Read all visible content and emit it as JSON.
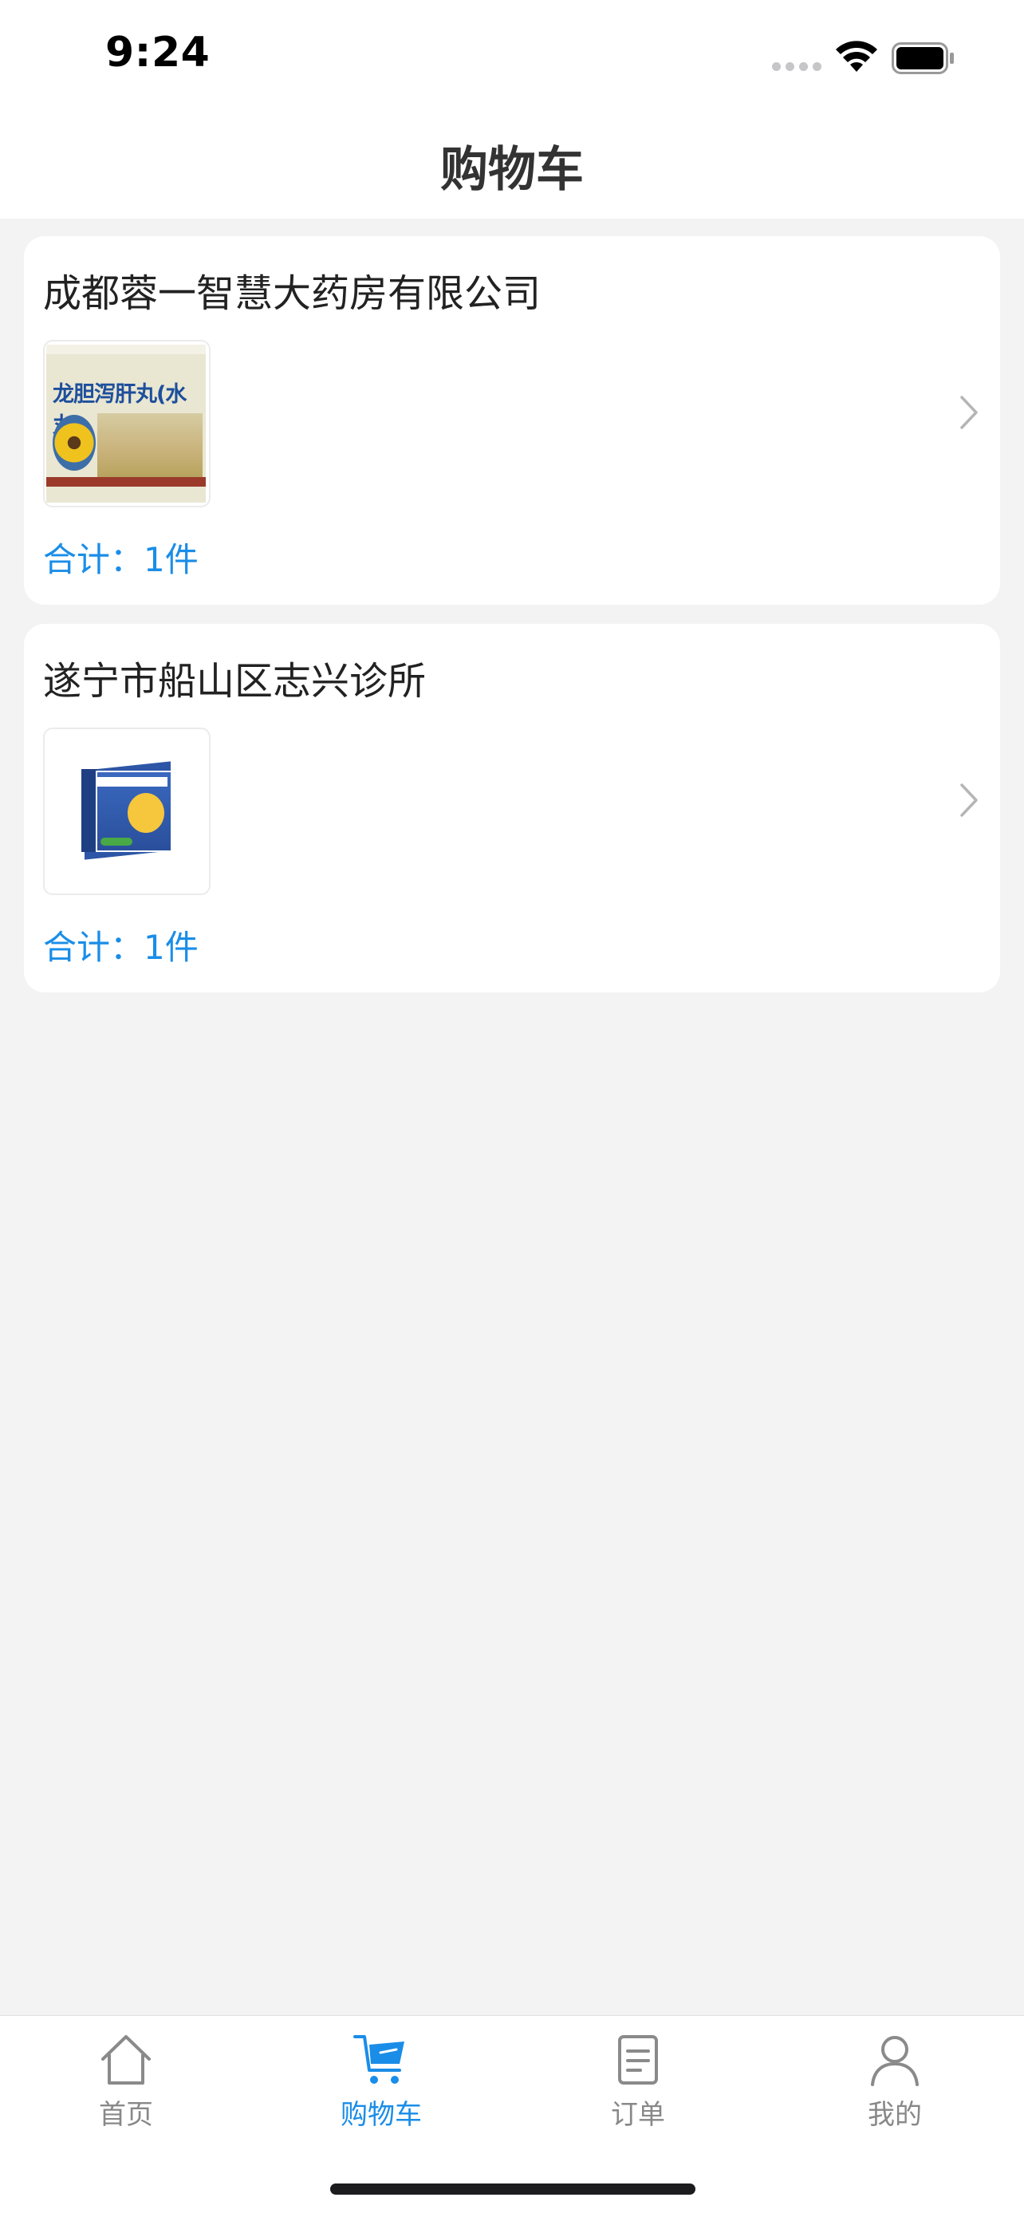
{
  "status_bar": {
    "time": "9:24",
    "icons": [
      "cellular-signal-icon",
      "wifi-icon",
      "battery-icon"
    ]
  },
  "header": {
    "title": "购物车"
  },
  "cart": {
    "stores": [
      {
        "name": "成都蓉一智慧大药房有限公司",
        "product_image": "longdan-xiegan-pill-box",
        "product_box_text": "龙胆泻肝丸(水丸)",
        "total": "合计：1件"
      },
      {
        "name": "遂宁市船山区志兴诊所",
        "product_image": "blue-children-medicine-box",
        "total": "合计：1件"
      }
    ]
  },
  "tab_bar": {
    "items": [
      {
        "label": "首页",
        "icon": "home-icon",
        "active": false
      },
      {
        "label": "购物车",
        "icon": "cart-icon",
        "active": true
      },
      {
        "label": "订单",
        "icon": "order-list-icon",
        "active": false
      },
      {
        "label": "我的",
        "icon": "user-icon",
        "active": false
      }
    ]
  },
  "colors": {
    "accent": "#1a8de8",
    "background": "#f3f3f4",
    "card": "#ffffff",
    "inactive_tab": "#888888"
  }
}
